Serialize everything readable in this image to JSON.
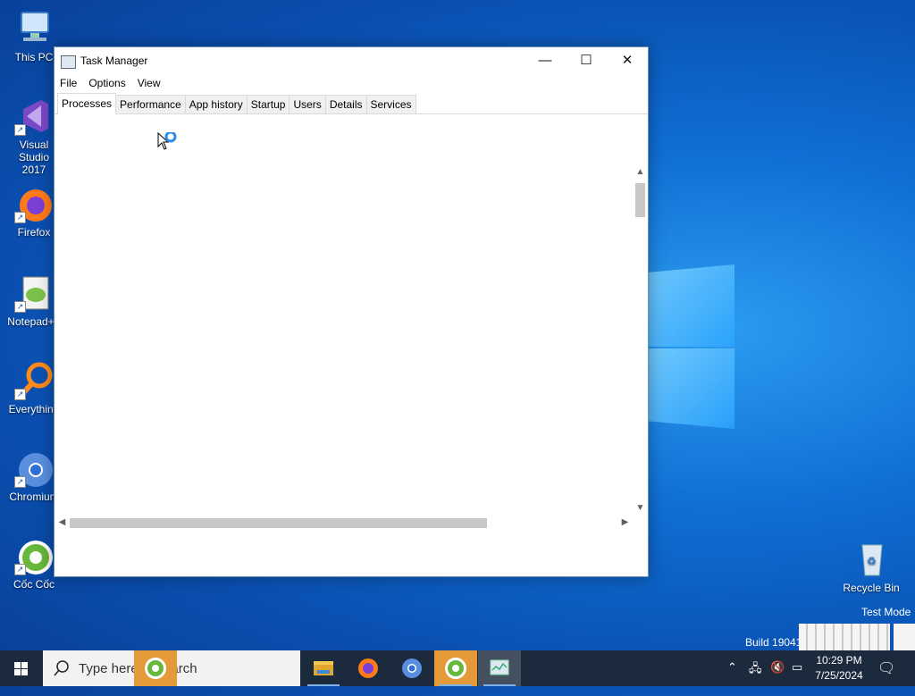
{
  "desktop": {
    "icons": [
      {
        "label": "This PC",
        "icon": "this-pc-icon"
      },
      {
        "label": "Visual Studio 2017",
        "icon": "visual-studio-icon"
      },
      {
        "label": "Firefox",
        "icon": "firefox-icon"
      },
      {
        "label": "Notepad++",
        "icon": "notepadpp-icon"
      },
      {
        "label": "Everything",
        "icon": "everything-icon"
      },
      {
        "label": "Chromium",
        "icon": "chromium-icon"
      },
      {
        "label": "Cốc Cốc",
        "icon": "coccoc-icon"
      }
    ],
    "recycle_bin": "Recycle Bin",
    "watermark": {
      "test_mode": "Test Mode",
      "build": "Build 19041"
    }
  },
  "window": {
    "title": "Task Manager",
    "menu": [
      "File",
      "Options",
      "View"
    ],
    "tabs": [
      "Processes",
      "Performance",
      "App history",
      "Startup",
      "Users",
      "Details",
      "Services"
    ],
    "active_tab": "Processes"
  },
  "taskbar": {
    "search_placeholder": "Type here to search",
    "apps": [
      "file-explorer-icon",
      "firefox-icon",
      "chromium-icon",
      "coccoc-icon",
      "task-manager-icon"
    ],
    "clock": {
      "time": "10:29 PM",
      "date": "7/25/2024"
    }
  },
  "colors": {
    "desktop": "#0f6fd4",
    "taskbar": "#1b2a3d",
    "accent": "#7fb2e8"
  }
}
